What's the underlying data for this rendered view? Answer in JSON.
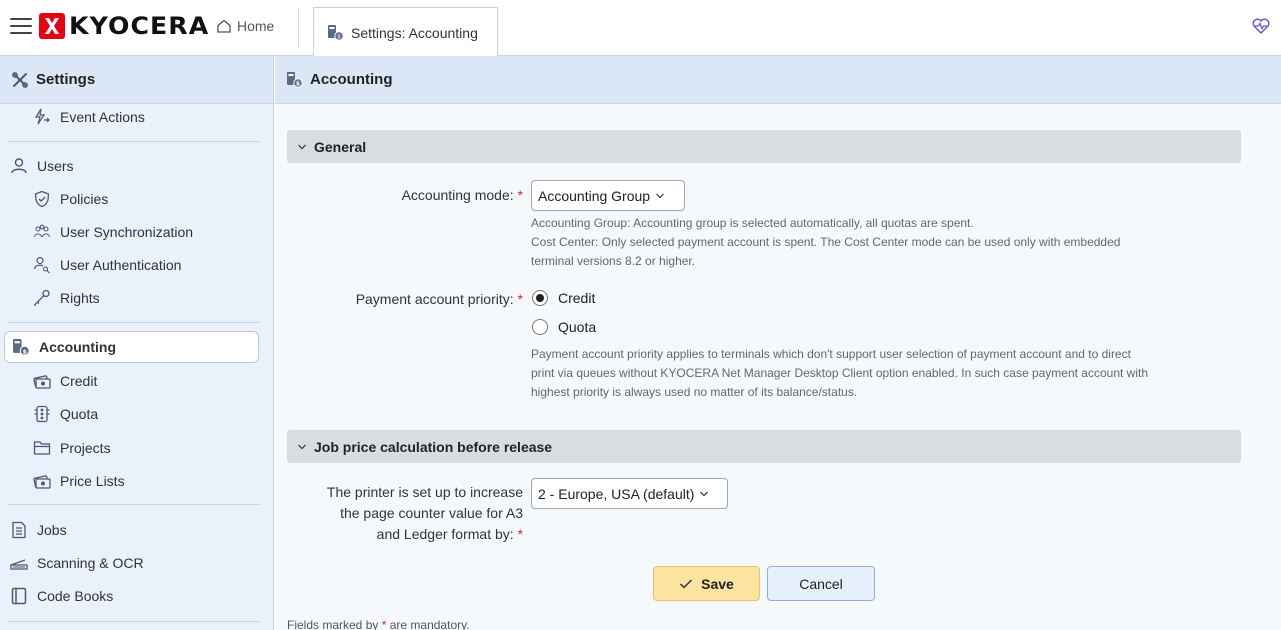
{
  "app": {
    "brand": "KYOCERA",
    "brand_color": "#e60012"
  },
  "tabs": {
    "home_label": "Home",
    "active_label": "Settings: Accounting"
  },
  "sidebar": {
    "title": "Settings",
    "items": [
      {
        "label": "Event Actions",
        "icon": "event-actions-icon"
      },
      {
        "label": "Users",
        "icon": "user-icon"
      },
      {
        "label": "Policies",
        "icon": "shield-check-icon"
      },
      {
        "label": "User Synchronization",
        "icon": "users-sync-icon"
      },
      {
        "label": "User Authentication",
        "icon": "user-key-icon"
      },
      {
        "label": "Rights",
        "icon": "key-icon"
      },
      {
        "label": "Accounting",
        "icon": "accounting-icon",
        "active": true
      },
      {
        "label": "Credit",
        "icon": "credit-icon"
      },
      {
        "label": "Quota",
        "icon": "quota-icon"
      },
      {
        "label": "Projects",
        "icon": "folder-icon"
      },
      {
        "label": "Price Lists",
        "icon": "price-list-icon"
      },
      {
        "label": "Jobs",
        "icon": "document-icon"
      },
      {
        "label": "Scanning & OCR",
        "icon": "scanner-icon"
      },
      {
        "label": "Code Books",
        "icon": "book-icon"
      }
    ]
  },
  "main": {
    "title": "Accounting",
    "sections": {
      "general": "General",
      "job_price": "Job price calculation before release"
    },
    "accounting_mode": {
      "label": "Accounting mode:",
      "required": "*",
      "value": "Accounting Group",
      "help_1": "Accounting Group: Accounting group is selected automatically, all quotas are spent.",
      "help_2": "Cost Center: Only selected payment account is spent. The Cost Center mode can be used only with embedded",
      "help_3": "terminal versions 8.2 or higher."
    },
    "payment_priority": {
      "label": "Payment account priority:",
      "required": "*",
      "options": [
        "Credit",
        "Quota"
      ],
      "selected": "Credit",
      "help_1": "Payment account priority applies to terminals which don't support user selection of payment account and to direct",
      "help_2": "print via queues without KYOCERA Net Manager Desktop Client option enabled. In such case payment account with",
      "help_3": "highest priority is always used no matter of its balance/status."
    },
    "page_counter": {
      "label_1": "The printer is set up to increase",
      "label_2": "the page counter value for A3",
      "label_3": "and Ledger format by:",
      "required": "*",
      "value": "2 - Europe, USA (default)"
    },
    "buttons": {
      "save": "Save",
      "cancel": "Cancel"
    },
    "footnote_prefix": "Fields marked by",
    "footnote_star": "*",
    "footnote_suffix": "are mandatory."
  }
}
